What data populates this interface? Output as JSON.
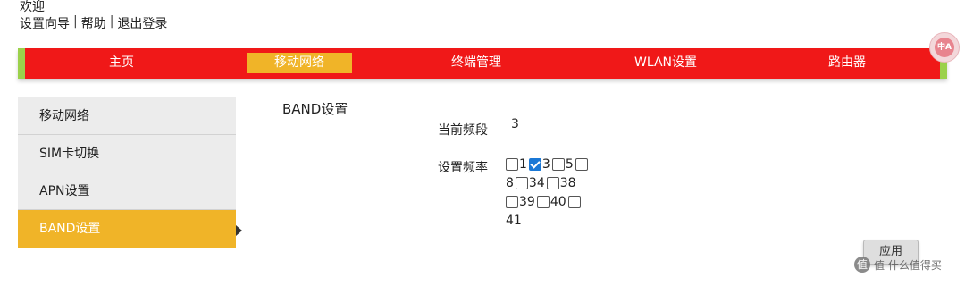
{
  "header": {
    "welcome": "欢迎",
    "links": [
      "设置向导",
      "帮助",
      "退出登录"
    ],
    "separator": "|"
  },
  "nav": {
    "items": [
      "主页",
      "移动网络",
      "终端管理",
      "WLAN设置",
      "路由器"
    ],
    "active_index": 1
  },
  "language_badge": "中A",
  "sidebar": {
    "items": [
      "移动网络",
      "SIM卡切换",
      "APN设置",
      "BAND设置"
    ],
    "active_index": 3
  },
  "main": {
    "section_title": "BAND设置",
    "current_band_label": "当前频段",
    "current_band_value": "3",
    "set_band_label": "设置频率",
    "bands": [
      {
        "value": "1",
        "checked": false
      },
      {
        "value": "3",
        "checked": true
      },
      {
        "value": "5",
        "checked": false
      },
      {
        "value": "8",
        "checked": false
      },
      {
        "value": "34",
        "checked": false
      },
      {
        "value": "38",
        "checked": false
      },
      {
        "value": "39",
        "checked": false
      },
      {
        "value": "40",
        "checked": false
      },
      {
        "value": "41",
        "checked": false
      }
    ],
    "apply_label": "应用"
  },
  "watermark": {
    "text": "值 什么值得买",
    "icon": "值"
  },
  "colors": {
    "nav_bg": "#f01818",
    "nav_edge": "#9bd14b",
    "active": "#f0b428",
    "checkbox_checked": "#1a78d6"
  }
}
